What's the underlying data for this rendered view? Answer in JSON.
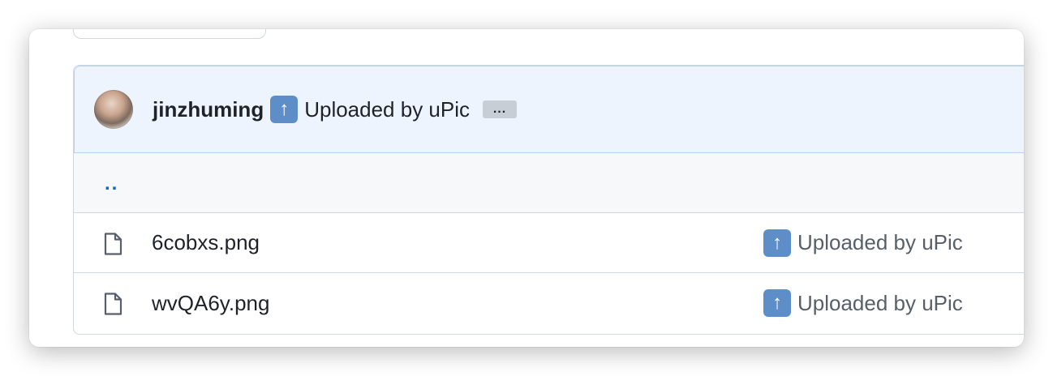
{
  "latest_commit": {
    "author": "jinzhuming",
    "emoji_icon": "arrow-up-emoji-icon",
    "message": "Uploaded by uPic",
    "more_label": "..."
  },
  "parent_dir": {
    "label": ".."
  },
  "files": [
    {
      "name": "6cobxs.png",
      "icon": "file-icon",
      "commit_message": "Uploaded by uPic"
    },
    {
      "name": "wvQA6y.png",
      "icon": "file-icon",
      "commit_message": "Uploaded by uPic"
    }
  ],
  "colors": {
    "commit_bar_bg": "#eef4fd",
    "link": "#0969da",
    "emoji_bg": "#5d8ec8"
  }
}
